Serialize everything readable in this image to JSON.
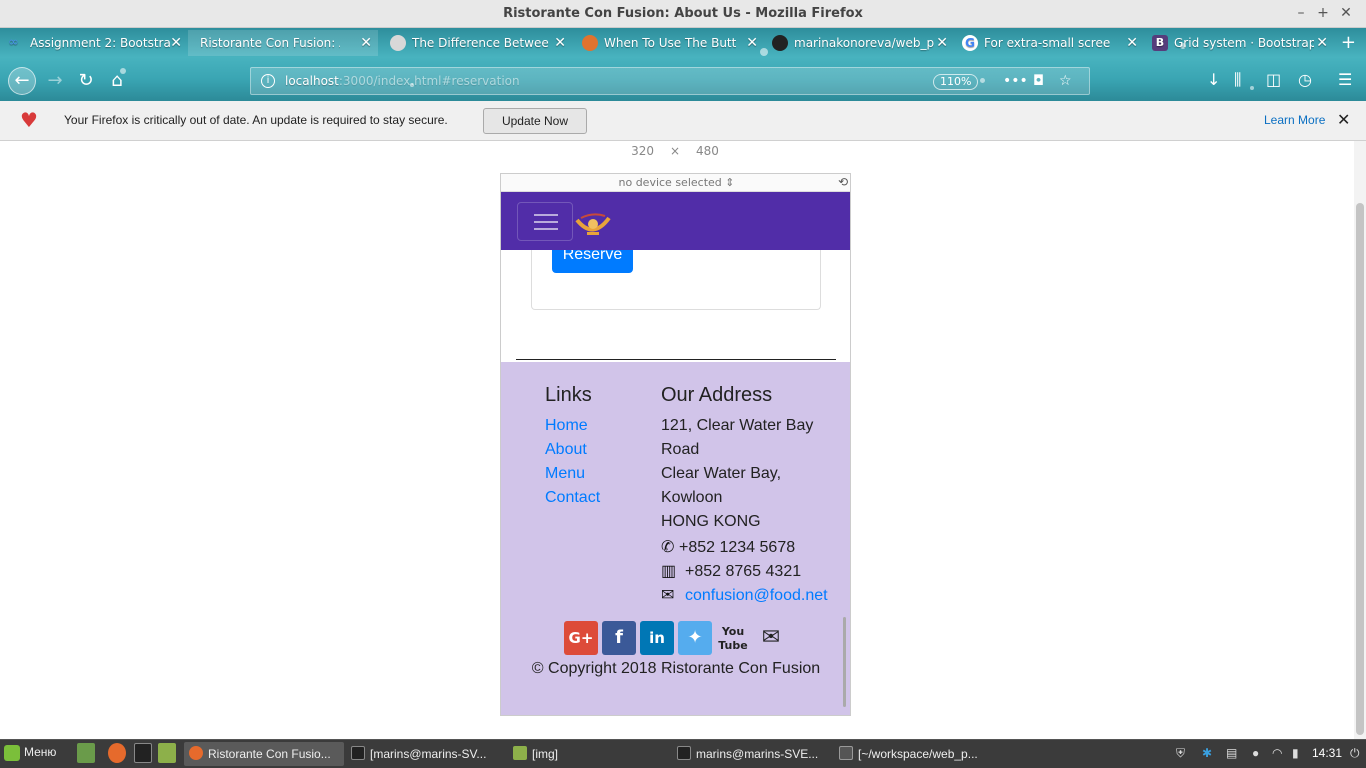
{
  "window": {
    "title": "Ristorante Con Fusion: About Us - Mozilla Firefox"
  },
  "tabs": [
    {
      "label": "Assignment 2: Bootstra",
      "icon": "link-icon",
      "color": "#4a90e2"
    },
    {
      "label": "Ristorante Con Fusion: Abo",
      "icon": "none",
      "color": "#ffffff"
    },
    {
      "label": "The Difference Betwee",
      "icon": "globe-icon",
      "color": "#555555"
    },
    {
      "label": "When To Use The Butt",
      "icon": "site-icon",
      "color": "#e0732e"
    },
    {
      "label": "marinakonoreva/web_p",
      "icon": "github-icon",
      "color": "#222222"
    },
    {
      "label": "For extra-small scree",
      "icon": "google-icon",
      "color": "#4285f4"
    },
    {
      "label": "Grid system · Bootstrap",
      "icon": "bootstrap-icon",
      "color": "#563d7c"
    }
  ],
  "urlbar": {
    "url_host": "localhost",
    "url_rest": ":3000/index.html#reservation",
    "zoom": "110%"
  },
  "notification": {
    "message": "Your Firefox is critically out of date. An update is required to stay secure.",
    "button": "Update Now",
    "learn_more": "Learn More"
  },
  "rdm": {
    "width": "320",
    "times": "×",
    "height": "480",
    "device": "no device selected"
  },
  "site": {
    "reserve_button": "Reserve",
    "footer": {
      "links_heading": "Links",
      "links": [
        "Home",
        "About",
        "Menu",
        "Contact"
      ],
      "address_heading": "Our Address",
      "address_lines": [
        "121, Clear Water Bay",
        "Road",
        "Clear Water Bay,",
        "Kowloon",
        "HONG KONG"
      ],
      "phone": "+852 1234 5678",
      "fax": "+852 8765 4321",
      "email": "confusion@food.net",
      "social": [
        "google-plus-icon",
        "facebook-icon",
        "linkedin-icon",
        "twitter-icon",
        "youtube-icon",
        "envelope-icon"
      ],
      "copyright": "© Copyright 2018 Ristorante Con Fusion"
    },
    "colors": {
      "navbar": "#512da8",
      "footer": "#d1c4e9",
      "primary": "#007bff"
    }
  },
  "taskbar": {
    "menu_label": "Меню",
    "tasks": [
      {
        "label": "Ristorante Con Fusio...",
        "active": true
      },
      {
        "label": "[marins@marins-SV...",
        "active": false
      },
      {
        "label": "[img]",
        "active": false
      },
      {
        "label": "marins@marins-SVE...",
        "active": false
      },
      {
        "label": "[~/workspace/web_p...",
        "active": false
      }
    ],
    "clock": "14:31"
  }
}
